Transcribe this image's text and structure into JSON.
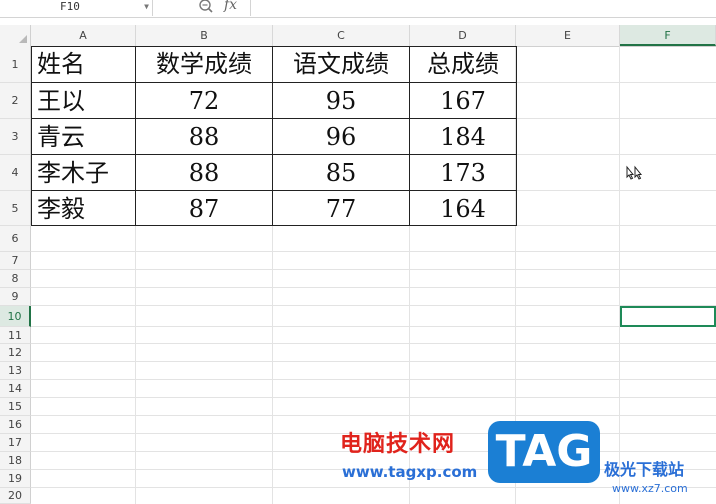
{
  "formula_bar": {
    "name_box": "F10",
    "fx_label": "fx",
    "formula": ""
  },
  "columns": [
    "A",
    "B",
    "C",
    "D",
    "E",
    "F"
  ],
  "selected_column": "F",
  "rows": [
    "1",
    "2",
    "3",
    "4",
    "5",
    "6",
    "7",
    "8",
    "9",
    "10",
    "11",
    "12",
    "13",
    "14",
    "15",
    "16",
    "17",
    "18",
    "19",
    "20"
  ],
  "selected_row": "10",
  "table": {
    "headers": [
      "姓名",
      "数学成绩",
      "语文成绩",
      "总成绩"
    ],
    "records": [
      [
        "王以",
        "72",
        "95",
        "167"
      ],
      [
        "青云",
        "88",
        "96",
        "184"
      ],
      [
        "李木子",
        "88",
        "85",
        "173"
      ],
      [
        "李毅",
        "87",
        "77",
        "164"
      ]
    ]
  },
  "watermark": {
    "title_cn": "电脑技术网",
    "url": "www.tagxp.com",
    "badge": "TAG",
    "site_cn": "极光下载站",
    "site_url": "www.xz7.com"
  },
  "colors": {
    "accent_green": "#217346",
    "active_border": "#1e8a58",
    "watermark_red": "#e0231c",
    "watermark_blue": "#1b7fd4"
  },
  "icons": [
    "zoom-icon",
    "fx-icon",
    "dropdown-arrow-icon",
    "select-all-icon",
    "cursor-icon"
  ]
}
